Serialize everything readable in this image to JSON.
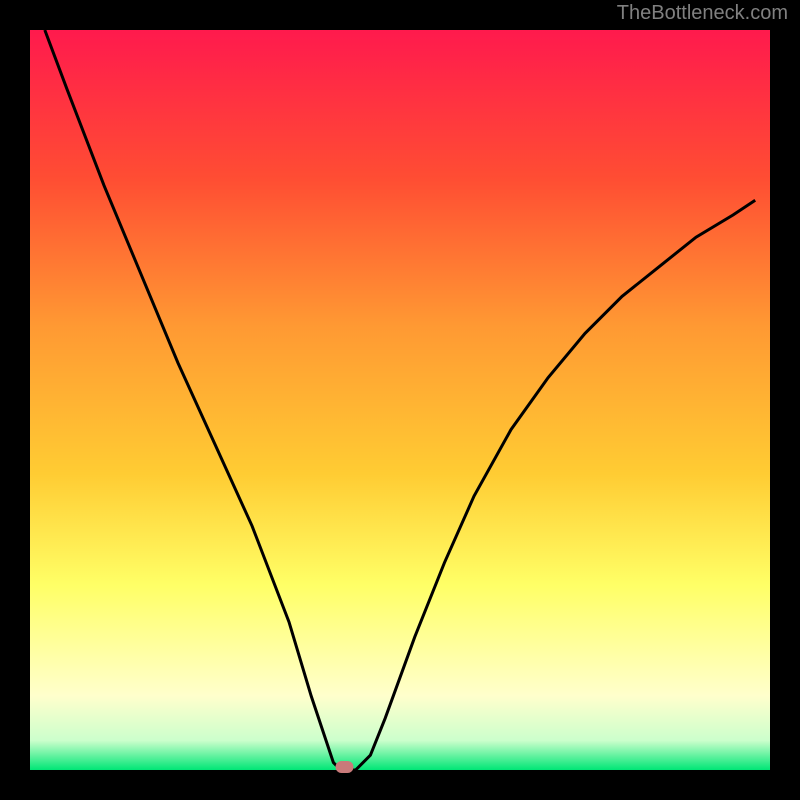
{
  "watermark": "TheBottleneck.com",
  "chart_data": {
    "type": "line",
    "title": "",
    "xlabel": "",
    "ylabel": "",
    "xlim": [
      0,
      100
    ],
    "ylim": [
      0,
      100
    ],
    "background": {
      "type": "gradient",
      "stops": [
        {
          "offset": 0,
          "color": "#ff1a4d"
        },
        {
          "offset": 20,
          "color": "#ff4d33"
        },
        {
          "offset": 40,
          "color": "#ff9933"
        },
        {
          "offset": 60,
          "color": "#ffcc33"
        },
        {
          "offset": 75,
          "color": "#ffff66"
        },
        {
          "offset": 90,
          "color": "#ffffcc"
        },
        {
          "offset": 96,
          "color": "#ccffcc"
        },
        {
          "offset": 100,
          "color": "#00e676"
        }
      ]
    },
    "frame_color": "#000000",
    "frame_thickness_px": 30,
    "series": [
      {
        "name": "bottleneck-curve",
        "type": "line",
        "color": "#000000",
        "x": [
          2,
          5,
          10,
          15,
          20,
          25,
          30,
          35,
          38,
          40,
          41,
          42,
          44,
          46,
          48,
          52,
          56,
          60,
          65,
          70,
          75,
          80,
          85,
          90,
          95,
          98
        ],
        "y": [
          100,
          92,
          79,
          67,
          55,
          44,
          33,
          20,
          10,
          4,
          1,
          0,
          0,
          2,
          7,
          18,
          28,
          37,
          46,
          53,
          59,
          64,
          68,
          72,
          75,
          77
        ]
      }
    ],
    "marker": {
      "name": "optimal-point",
      "x": 42.5,
      "y": 0,
      "color": "#c97a7a",
      "shape": "rounded-rect"
    }
  }
}
